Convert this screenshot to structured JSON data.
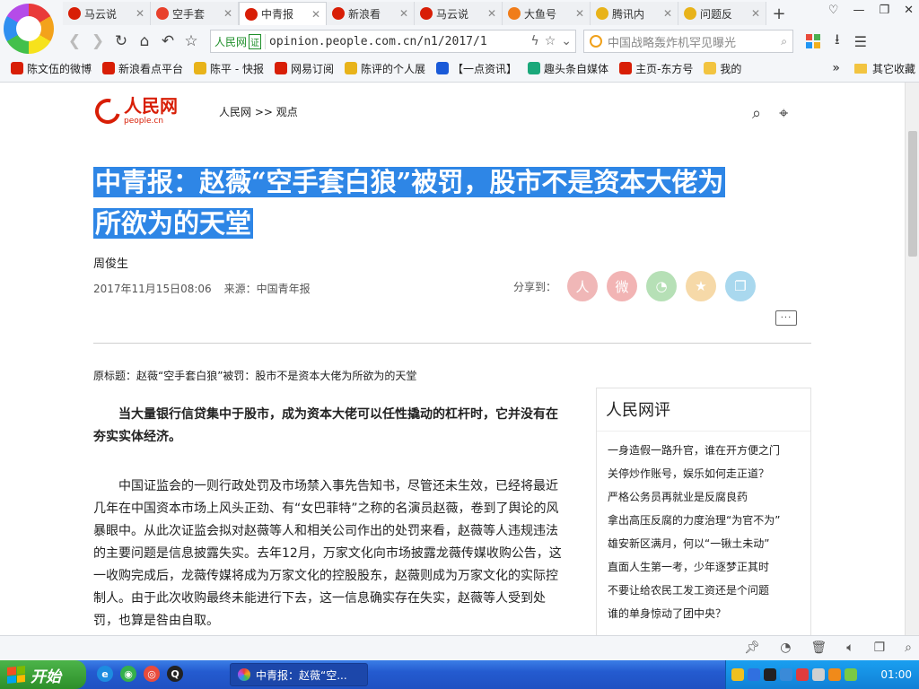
{
  "browser": {
    "tabs": [
      {
        "label": "马云说",
        "icon_color": "#d81e06",
        "icon": "weibo-icon"
      },
      {
        "label": "空手套",
        "icon_color": "#e8412c",
        "icon": "sohu-icon"
      },
      {
        "label": "中青报",
        "icon_color": "#d81e06",
        "icon": "people-icon",
        "active": true
      },
      {
        "label": "新浪看",
        "icon_color": "#d81e06",
        "icon": "weibo-icon"
      },
      {
        "label": "马云说",
        "icon_color": "#d81e06",
        "icon": "weibo-icon"
      },
      {
        "label": "大鱼号",
        "icon_color": "#f07d1a",
        "icon": "dayu-icon"
      },
      {
        "label": "腾讯内",
        "icon_color": "#e8b31a",
        "icon": "tencent-icon"
      },
      {
        "label": "问题反",
        "icon_color": "#e8b31a",
        "icon": "tencent-icon"
      }
    ],
    "address": {
      "cert_label": "人民网",
      "cert_badge": "证",
      "url": "opinion.people.com.cn/n1/2017/1"
    },
    "search": {
      "placeholder": "中国战略轰炸机罕见曝光"
    },
    "bookmarks": [
      {
        "label": "陈文伍的微博",
        "icon_color": "#d81e06"
      },
      {
        "label": "新浪看点平台",
        "icon_color": "#d81e06"
      },
      {
        "label": "陈平 - 快报",
        "icon_color": "#e8b31a"
      },
      {
        "label": "网易订阅",
        "icon_color": "#d81e06"
      },
      {
        "label": "陈评的个人展",
        "icon_color": "#e8b31a"
      },
      {
        "label": "【一点资讯】",
        "icon_color": "#1a5ad8"
      },
      {
        "label": "趣头条自媒体",
        "icon_color": "#1aa87a"
      },
      {
        "label": "主页-东方号",
        "icon_color": "#d81e06"
      },
      {
        "label": "我的",
        "icon_color": "#f2c440"
      }
    ],
    "bookmarks_more": "»",
    "bookmarks_other": "其它收藏"
  },
  "page": {
    "breadcrumb": "人民网 >> 观点",
    "logo_text": "人民网",
    "logo_sub": "people.cn",
    "headline_line1": "中青报：赵薇“空手套白狼”被罚，股市不是资本大佬为",
    "headline_line2": "所欲为的天堂",
    "author": "周俊生",
    "date": "2017年11月15日08:06",
    "source": "来源：中国青年报",
    "share_label": "分享到：",
    "share_buttons": [
      {
        "icon": "people-share-icon",
        "glyph": "人",
        "color": "#f0b7b7"
      },
      {
        "icon": "weibo-share-icon",
        "glyph": "微",
        "color": "#f2b4b4"
      },
      {
        "icon": "wechat-share-icon",
        "glyph": "◔",
        "color": "#b6e0b6"
      },
      {
        "icon": "qzone-share-icon",
        "glyph": "★",
        "color": "#f6d9a8"
      },
      {
        "icon": "copy-share-icon",
        "glyph": "❐",
        "color": "#a9d8ee"
      }
    ],
    "comment_glyph": "···",
    "original_title": "原标题：赵薇“空手套白狼”被罚：股市不是资本大佬为所欲为的天堂",
    "lead": "当大量银行信贷集中于股市，成为资本大佬可以任性撬动的杠杆时，它并没有在夯实实体经济。",
    "body": "中国证监会的一则行政处罚及市场禁入事先告知书，尽管还未生效，已经将最近几年在中国资本市场上风头正劲、有“女巴菲特”之称的名演员赵薇，卷到了舆论的风暴眼中。从此次证监会拟对赵薇等人和相关公司作出的处罚来看，赵薇等人违规违法的主要问题是信息披露失实。去年12月，万家文化向市场披露龙薇传媒收购公告，这一收购完成后，龙薇传媒将成为万家文化的控股股东，赵薇则成为万家文化的实际控制人。由于此次收购最终未能进行下去，这一信息确实存在失实，赵薇等人受到处罚，也算是咎由自取。",
    "sidebar_title": "人民网评",
    "sidebar_items": [
      "一身造假一路升官，谁在开方便之门",
      "关停炒作账号，娱乐如何走正道？",
      "严格公务员再就业是反腐良药",
      "拿出高压反腐的力度治理“为官不为”",
      "雄安新区满月，何以“一锹土未动”",
      "直面人生第一考，少年逐梦正其时",
      "不要让给农民工发工资还是个问题",
      "谁的单身惊动了团中央？"
    ]
  },
  "taskbar": {
    "start_label": "开始",
    "task_label": "中青报：赵薇“空...",
    "clock": "01:00"
  }
}
